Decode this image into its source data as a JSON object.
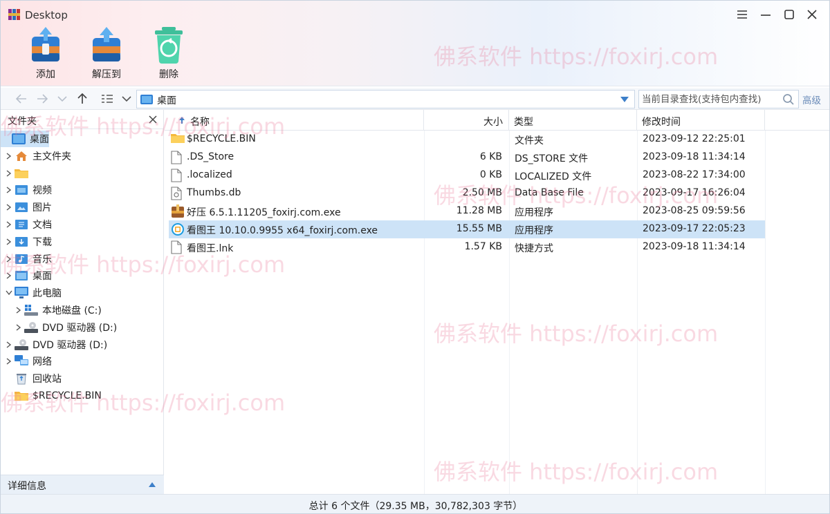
{
  "window": {
    "title": "Desktop"
  },
  "toolbar": {
    "add": "添加",
    "extract": "解压到",
    "delete": "删除"
  },
  "nav": {
    "path": "桌面",
    "search_placeholder": "当前目录查找(支持包内查找)",
    "advanced": "高级"
  },
  "sidebar": {
    "title": "文件夹",
    "items": [
      {
        "label": "桌面",
        "icon": "desktop-icon",
        "chev": "",
        "indent": 0,
        "selected": true
      },
      {
        "label": "主文件夹",
        "icon": "home-icon",
        "chev": "right",
        "indent": 0
      },
      {
        "label": "",
        "icon": "folder-icon",
        "chev": "right",
        "indent": 0
      },
      {
        "label": "视频",
        "icon": "video-folder-icon",
        "chev": "right",
        "indent": 0
      },
      {
        "label": "图片",
        "icon": "picture-folder-icon",
        "chev": "right",
        "indent": 0
      },
      {
        "label": "文档",
        "icon": "document-folder-icon",
        "chev": "right",
        "indent": 0
      },
      {
        "label": "下载",
        "icon": "download-folder-icon",
        "chev": "right",
        "indent": 0
      },
      {
        "label": "音乐",
        "icon": "music-folder-icon",
        "chev": "right",
        "indent": 0
      },
      {
        "label": "桌面",
        "icon": "desktop-folder-icon",
        "chev": "right",
        "indent": 0
      },
      {
        "label": "此电脑",
        "icon": "computer-icon",
        "chev": "down",
        "indent": 0
      },
      {
        "label": "本地磁盘 (C:)",
        "icon": "local-disk-icon",
        "chev": "right",
        "indent": 1
      },
      {
        "label": "DVD 驱动器 (D:)",
        "icon": "dvd-drive-icon",
        "chev": "right",
        "indent": 1
      },
      {
        "label": "DVD 驱动器 (D:)",
        "icon": "dvd-drive-icon",
        "chev": "right",
        "indent": 0
      },
      {
        "label": "网络",
        "icon": "network-icon",
        "chev": "right",
        "indent": 0
      },
      {
        "label": "回收站",
        "icon": "recycle-bin-icon",
        "chev": "",
        "indent": 0
      },
      {
        "label": "$RECYCLE.BIN",
        "icon": "folder-icon",
        "chev": "",
        "indent": 0
      }
    ],
    "detail": "详细信息"
  },
  "columns": {
    "name": "名称",
    "size": "大小",
    "type": "类型",
    "modified": "修改时间"
  },
  "files": [
    {
      "name": "$RECYCLE.BIN",
      "size": "",
      "type": "文件夹",
      "modified": "2023-09-12 22:25:01",
      "icon": "folder-icon"
    },
    {
      "name": ".DS_Store",
      "size": "6 KB",
      "type": "DS_STORE 文件",
      "modified": "2023-09-18 11:34:14",
      "icon": "file-icon"
    },
    {
      "name": ".localized",
      "size": "0 KB",
      "type": "LOCALIZED 文件",
      "modified": "2023-08-22 17:34:00",
      "icon": "file-icon"
    },
    {
      "name": "Thumbs.db",
      "size": "2.50 MB",
      "type": "Data Base File",
      "modified": "2023-09-17 16:26:04",
      "icon": "db-file-icon"
    },
    {
      "name": "好压 6.5.1.11205_foxirj.com.exe",
      "size": "11.28 MB",
      "type": "应用程序",
      "modified": "2023-08-25 09:59:56",
      "icon": "archive-exe-icon"
    },
    {
      "name": "看图王 10.10.0.9955 x64_foxirj.com.exe",
      "size": "15.55 MB",
      "type": "应用程序",
      "modified": "2023-09-17 22:05:23",
      "icon": "image-viewer-exe-icon",
      "selected": true
    },
    {
      "name": "看图王.lnk",
      "size": "1.57 KB",
      "type": "快捷方式",
      "modified": "2023-09-18 11:34:14",
      "icon": "shortcut-file-icon"
    }
  ],
  "status": "总计 6 个文件（29.35 MB，30,782,303 字节）",
  "watermark": "佛系软件 https://foxirj.com",
  "colors": {
    "accent": "#2f7fd4",
    "selection": "#cde3f7",
    "header_pink": "#fde4e6",
    "watermark": "#e87896"
  }
}
